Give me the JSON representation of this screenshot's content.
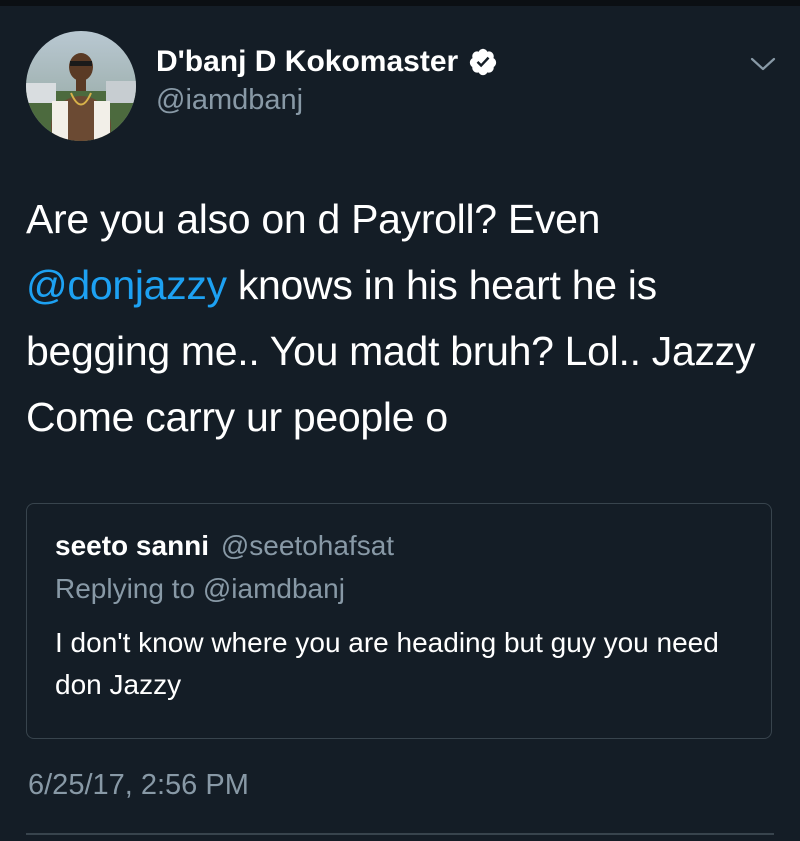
{
  "tweet": {
    "author": {
      "display_name": "D'banj D Kokomaster",
      "handle": "@iamdbanj",
      "verified": true
    },
    "text": {
      "part1": "Are you also on d Payroll? Even",
      "mention": "@donjazzy",
      "part2": " knows in his heart he is begging me.. You madt bruh? Lol.. Jazzy Come carry ur people o"
    },
    "quoted": {
      "name": "seeto sanni",
      "handle": "@seetohafsat",
      "replying_to": "Replying to @iamdbanj",
      "text": "I don't know where you are heading but guy you need don Jazzy"
    },
    "timestamp": "6/25/17, 2:56 PM"
  },
  "icons": {
    "verified": "verified-badge-icon",
    "menu": "chevron-down-icon"
  },
  "colors": {
    "background": "#141d26",
    "text": "#ffffff",
    "secondary": "#8899a6",
    "link": "#1da1f2",
    "border": "#38444d"
  }
}
